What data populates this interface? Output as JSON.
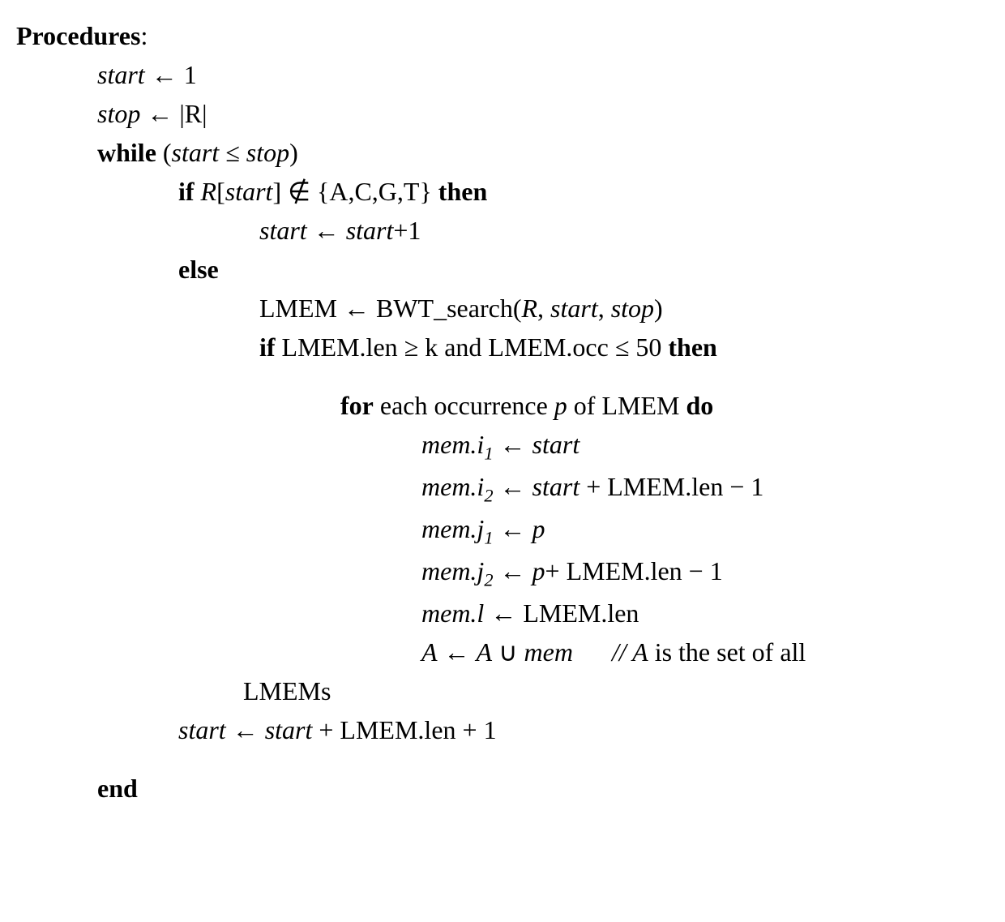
{
  "header": "Procedures",
  "colon": ":",
  "lines": {
    "l1": {
      "start": "start",
      "arrow": "←",
      "one": "1"
    },
    "l2": {
      "stop": "stop",
      "arrow": "←",
      "abs": "|R|"
    },
    "l3": {
      "while": "while",
      "open": "(",
      "start": "start",
      "le": "≤",
      "stop": "stop",
      "close": ")"
    },
    "l4": {
      "if": "if",
      "R": "R",
      "open": "[",
      "start": "start",
      "close": "]",
      "notin": "∉",
      "set": "{A,C,G,T}",
      "then": "then"
    },
    "l5": {
      "start1": "start",
      "arrow": "←",
      "start2": "start",
      "plus1": "+1"
    },
    "l6": {
      "else": "else"
    },
    "l7": {
      "lmem": "LMEM",
      "arrow": "←",
      "fn": "BWT_search(",
      "R": "R",
      "c1": ", ",
      "start": "start",
      "c2": ", ",
      "stop": "stop",
      "close": ")"
    },
    "l8": {
      "if": "if",
      "lmemlen": "LMEM.len",
      "ge": "≥",
      "k": "k",
      "and": "and",
      "lmemocc": "LMEM.occ",
      "le": "≤",
      "fifty": "50",
      "then": "then"
    },
    "l9": {
      "for": "for",
      "each": "each occurrence ",
      "p": "p",
      "of": " of LMEM ",
      "do": "do"
    },
    "l10": {
      "mem": "mem.i",
      "sub": "1",
      "arrow": " ← ",
      "start": "start"
    },
    "l11": {
      "mem": "mem.i",
      "sub": "2",
      "arrow": " ← ",
      "start": "start",
      "rest": " + LMEM.len − 1"
    },
    "l12": {
      "mem": "mem.j",
      "sub": "1",
      "arrow": " ← ",
      "p": "p"
    },
    "l13": {
      "mem": "mem.j",
      "sub": "2",
      "arrow": " ← ",
      "p": "p",
      "rest": "+ LMEM.len − 1"
    },
    "l14": {
      "mem": "mem.l",
      "arrow": " ← ",
      "rest": "LMEM.len"
    },
    "l15": {
      "A1": "A",
      "arrow": " ← ",
      "A2": "A",
      "cup": " ∪ ",
      "mem": "mem",
      "spaces": "      ",
      "slashes": "// ",
      "A3": "A",
      "rest": " is the set of all"
    },
    "l16": {
      "text": "LMEMs"
    },
    "l17": {
      "start1": "start",
      "arrow": " ← ",
      "start2": "start",
      "rest": " + LMEM.len + 1"
    },
    "l18": {
      "end": "end"
    }
  }
}
